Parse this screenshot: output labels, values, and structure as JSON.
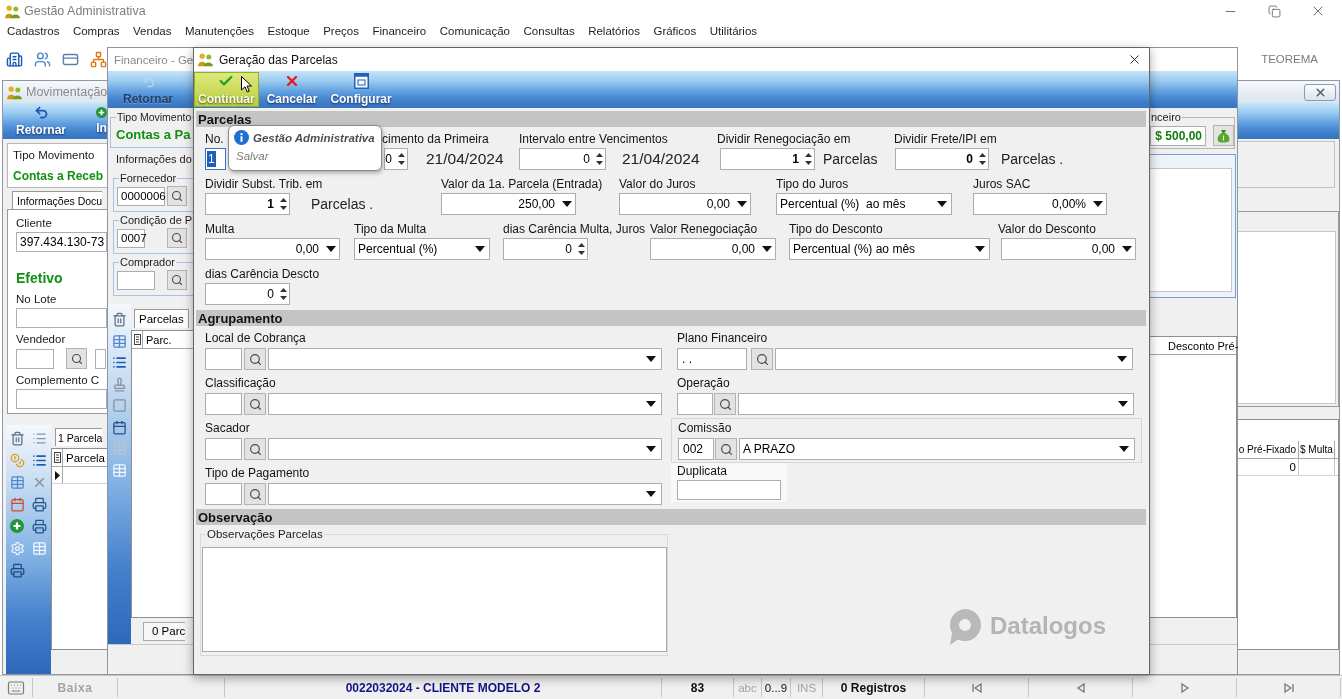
{
  "app": {
    "title": "Gestão Administrativa",
    "menu": [
      "Cadastros",
      "Compras",
      "Vendas",
      "Manutenções",
      "Estoque",
      "Preços",
      "Financeiro",
      "Comunicação",
      "Consultas",
      "Relatórios",
      "Gráficos",
      "Utilitários"
    ],
    "brand": "TEOREMA"
  },
  "window_back": {
    "title": "Movimentação",
    "toolbar": [
      {
        "label": "Retornar",
        "disabled": false
      },
      {
        "label": "In",
        "disabled": false
      }
    ],
    "tipo_movimento": {
      "label": "Tipo Movimento",
      "value": "Contas a Receb"
    },
    "tab": "Informações Docu",
    "cliente": {
      "label": "Cliente",
      "value": "397.434.130-73"
    },
    "status": "Efetivo",
    "no_lote": {
      "label": "No Lote"
    },
    "vendedor": {
      "label": "Vendedor"
    },
    "complemento": {
      "label": "Complemento C"
    },
    "grid_tab": "1 Parcela",
    "left_columns": [
      "Parcela"
    ],
    "right_columns": [
      "o Pré-Fixado",
      "$ Multa"
    ],
    "rows": [
      {
        "current": true,
        "cells": [
          "0"
        ]
      }
    ]
  },
  "window_mid": {
    "title": "Financeiro - Ge",
    "toolbar": [
      {
        "label": "Retornar",
        "disabled": true
      }
    ],
    "tipo_movimento": {
      "label": "Tipo Movimento",
      "value": "Contas a Pa"
    },
    "tab": "Informações do",
    "groups": [
      {
        "label": "Fornecedor",
        "code": "0000006"
      },
      {
        "label": "Condição de P",
        "code": "0007"
      },
      {
        "label": "Comprador"
      }
    ],
    "grid_tab": "Parcelas",
    "columns": [
      "Parc."
    ],
    "footer": "0 Parc",
    "financeiro": {
      "label": "nceiro",
      "value": "$ 500,00"
    },
    "right_columns": [
      "Desconto Pré-"
    ]
  },
  "dialog": {
    "title": "Geração das Parcelas",
    "toolbar": [
      {
        "label": "Continuar",
        "hovered": true
      },
      {
        "label": "Cancelar",
        "hovered": false
      },
      {
        "label": "Configurar",
        "hovered": false
      }
    ],
    "tooltip": {
      "title": "Gestão Administrativa",
      "text": "Salvar"
    },
    "parcelas": {
      "title": "Parcelas",
      "rows": [
        [
          {
            "label": "No.",
            "kind": "text",
            "value": "1",
            "focused": true
          },
          {
            "label": "cimento da Primeira",
            "kind": "spin",
            "value": "0",
            "focused": false,
            "suffix": "21/04/2024"
          },
          {
            "label": "Intervalo entre Vencimentos",
            "kind": "spin",
            "value": "0",
            "focused": false,
            "suffix": "21/04/2024"
          },
          {
            "label": "Dividir Renegociação em",
            "kind": "spin",
            "value": "1",
            "focused": false,
            "suffix": "Parcelas"
          },
          {
            "label": "Dividir Frete/IPI em",
            "kind": "spin",
            "value": "0",
            "focused": false,
            "suffix": "Parcelas ."
          }
        ],
        [
          {
            "label": "Dividir Subst. Trib. em",
            "kind": "spin",
            "value": "1",
            "focused": false,
            "suffix": "Parcelas ."
          },
          {
            "label": "Valor da 1a. Parcela (Entrada)",
            "kind": "amount",
            "value": "250,00",
            "focused": false
          },
          {
            "label": "Valor do Juros",
            "kind": "amount",
            "value": "0,00",
            "focused": false
          },
          {
            "label": "Tipo do Juros",
            "kind": "combo",
            "value": "Percentual (%)  ao mês",
            "focused": false
          },
          {
            "label": "Juros SAC",
            "kind": "amount",
            "value": "0,00%",
            "focused": false
          }
        ],
        [
          {
            "label": "Multa",
            "kind": "amount",
            "value": "0,00",
            "focused": false
          },
          {
            "label": "Tipo da Multa",
            "kind": "combo",
            "value": "Percentual (%)",
            "focused": false
          },
          {
            "label": "dias Carência Multa, Juros",
            "kind": "spin",
            "value": "0",
            "focused": false
          },
          {
            "label": "Valor Renegociação",
            "kind": "amount",
            "value": "0,00",
            "focused": false
          },
          {
            "label": "Tipo do Desconto",
            "kind": "combo",
            "value": "Percentual (%) ao mês",
            "focused": false
          },
          {
            "label": "Valor do Desconto",
            "kind": "amount",
            "value": "0,00",
            "focused": false
          }
        ],
        [
          {
            "label": "dias Carência Descto",
            "kind": "spin",
            "value": "0",
            "focused": false
          }
        ]
      ]
    },
    "agrupamento": {
      "title": "Agrupamento",
      "left": [
        {
          "label": "Local de Cobrança",
          "kind": "lookup"
        },
        {
          "label": "Classificação",
          "kind": "lookup"
        },
        {
          "label": "Sacador",
          "kind": "lookup"
        },
        {
          "label": "Tipo de Pagamento",
          "kind": "lookup"
        }
      ],
      "right": [
        {
          "label": "Plano Financeiro",
          "kind": "lookup",
          "code": ". ."
        },
        {
          "label": "Operação",
          "kind": "lookup"
        },
        {
          "label": "Comissão",
          "kind": "lookup",
          "code": "002",
          "value": "A PRAZO"
        },
        {
          "label": "Duplicata",
          "kind": "text"
        }
      ]
    },
    "observacao": {
      "title": "Observação",
      "group_label": "Observações Parcelas"
    },
    "logo": "Datalogos"
  },
  "status_bar": {
    "cells": [
      {
        "text": "Baixa",
        "disabled": true
      },
      {
        "text": "0022032024 - CLIENTE MODELO 2",
        "disabled": false
      },
      {
        "text": "83",
        "disabled": false
      },
      {
        "text": "abc",
        "disabled": true
      },
      {
        "text": "0...9",
        "disabled": false
      },
      {
        "text": "INS",
        "disabled": true
      },
      {
        "text": "0 Registros",
        "disabled": false
      }
    ]
  }
}
